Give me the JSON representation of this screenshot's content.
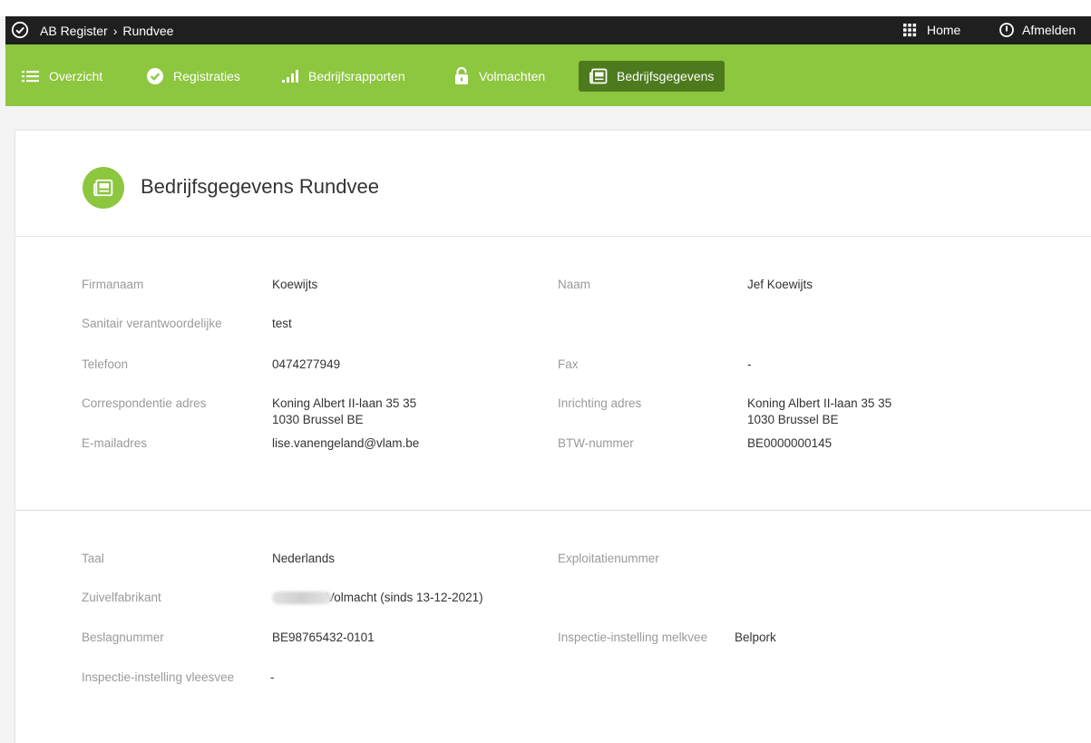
{
  "topbar": {
    "breadcrumb_app": "AB Register",
    "breadcrumb_sep": "›",
    "breadcrumb_section": "Rundvee",
    "home_label": "Home",
    "logout_label": "Afmelden"
  },
  "nav": {
    "items": [
      {
        "label": "Overzicht",
        "icon": "list-icon"
      },
      {
        "label": "Registraties",
        "icon": "check-circle-icon"
      },
      {
        "label": "Bedrijfsrapporten",
        "icon": "bar-signal-icon"
      },
      {
        "label": "Volmachten",
        "icon": "lock-icon"
      },
      {
        "label": "Bedrijfsgegevens",
        "icon": "newspaper-icon",
        "active": true
      }
    ]
  },
  "page": {
    "title": "Bedrijfsgegevens Rundvee"
  },
  "details": {
    "firmanaam_label": "Firmanaam",
    "firmanaam_value": "Koewijts",
    "naam_label": "Naam",
    "naam_value": "Jef Koewijts",
    "sanitair_label": "Sanitair verantwoordelijke",
    "sanitair_value": "test",
    "telefoon_label": "Telefoon",
    "telefoon_value": "0474277949",
    "fax_label": "Fax",
    "fax_value": "-",
    "corr_adres_label": "Correspondentie adres",
    "corr_adres_line1": "Koning Albert II-laan 35 35",
    "corr_adres_line2": "1030 Brussel BE",
    "inr_adres_label": "Inrichting adres",
    "inr_adres_line1": "Koning Albert II-laan 35 35",
    "inr_adres_line2": "1030 Brussel BE",
    "email_label": "E-mailadres",
    "email_value": "lise.vanengeland@vlam.be",
    "btw_label": "BTW-nummer",
    "btw_value": "BE0000000145"
  },
  "extra": {
    "taal_label": "Taal",
    "taal_value": "Nederlands",
    "exploitatie_label": "Exploitatienummer",
    "exploitatie_value": "",
    "zuivel_label": "Zuivelfabrikant",
    "zuivel_value": "Volmacht (sinds 13-12-2021)",
    "beslag_label": "Beslagnummer",
    "beslag_value": "BE98765432-0101",
    "insp_melk_label": "Inspectie-instelling melkvee",
    "insp_melk_value": "Belpork",
    "insp_vlees_label": "Inspectie-instelling vleesvee",
    "insp_vlees_value": "-"
  },
  "colors": {
    "topbar_bg": "#1f1f1f",
    "nav_green": "#8dc63f",
    "nav_active": "#4e7a1e"
  }
}
